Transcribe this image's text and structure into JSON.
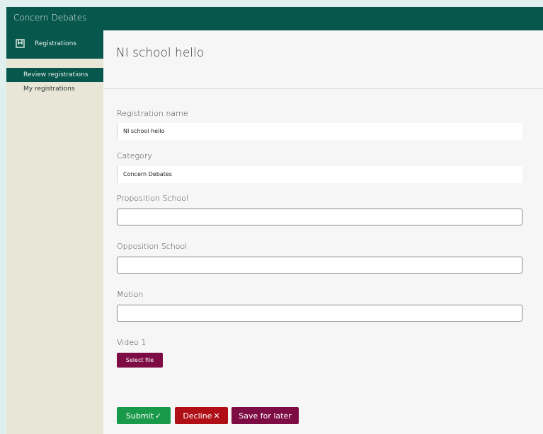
{
  "app": {
    "title": "Concern Debates"
  },
  "sidebar": {
    "section_label": "Registrations",
    "section_icon": "bookmark-icon",
    "items": [
      {
        "label": "Review registrations",
        "active": true
      },
      {
        "label": "My registrations",
        "active": false
      }
    ]
  },
  "main": {
    "title": "NI school hello",
    "fields": {
      "registration_name": {
        "label": "Registration name",
        "value": "NI school hello"
      },
      "category": {
        "label": "Category",
        "value": "Concern Debates"
      },
      "proposition_school": {
        "label": "Proposition School",
        "value": ""
      },
      "opposition_school": {
        "label": "Opposition School",
        "value": ""
      },
      "motion": {
        "label": "Motion",
        "value": ""
      },
      "video_1": {
        "label": "Video 1",
        "button_label": "Select file"
      }
    },
    "actions": {
      "submit": {
        "label": "Submit",
        "icon": "check-icon",
        "glyph": "✓"
      },
      "decline": {
        "label": "Decline",
        "icon": "close-icon",
        "glyph": "✕"
      },
      "save_for_later": {
        "label": "Save for later"
      }
    }
  },
  "colors": {
    "header": "#07574d",
    "sidebar": "#e8e6d6",
    "submit": "#199a4b",
    "decline": "#b00f17",
    "save": "#7d0c45"
  }
}
